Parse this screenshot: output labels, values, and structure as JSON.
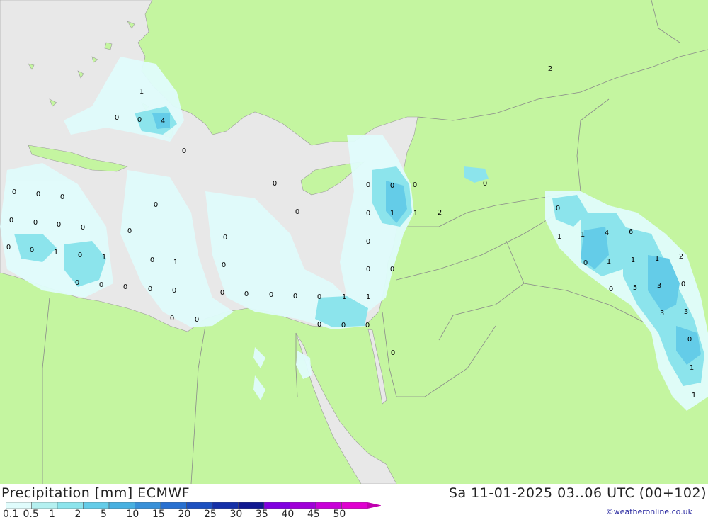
{
  "title": "Precipitation [mm] ECMWF",
  "valid_time": "Sa 11-01-2025 03..06 UTC (00+102)",
  "credit": "©weatheronline.co.uk",
  "colors": {
    "land": "#c4f5a0",
    "sea": "#e8e8e8",
    "border": "#999999",
    "scale": [
      "#e0fcfc",
      "#b4f0f0",
      "#8ce4ec",
      "#64cce8",
      "#48b0e0",
      "#3890d8",
      "#2870d0",
      "#1c50c0",
      "#1430a8",
      "#101890",
      "#8000e0",
      "#a000d8",
      "#c800d8",
      "#e000d0",
      "#c000b0"
    ]
  },
  "legend": {
    "labels": [
      "0.1",
      "0.5",
      "1",
      "2",
      "5",
      "10",
      "15",
      "20",
      "25",
      "30",
      "35",
      "40",
      "45",
      "50"
    ]
  },
  "values": [
    "1",
    "0",
    "0",
    "4",
    "0",
    "0",
    "0",
    "0",
    "0",
    "0",
    "0",
    "0",
    "0",
    "0",
    "0",
    "0",
    "0",
    "0",
    "0",
    "1",
    "0",
    "1",
    "0",
    "1",
    "0",
    "0",
    "0",
    "0",
    "0",
    "0",
    "0",
    "0",
    "0",
    "0",
    "0",
    "1",
    "1",
    "0",
    "0",
    "0",
    "0",
    "0",
    "0",
    "0",
    "0",
    "0",
    "0",
    "0",
    "1",
    "1",
    "2",
    "0",
    "0",
    "0",
    "2",
    "0",
    "1",
    "1",
    "4",
    "6",
    "0",
    "1",
    "1",
    "1",
    "2",
    "0",
    "5",
    "3",
    "0",
    "3",
    "3",
    "0",
    "1"
  ]
}
